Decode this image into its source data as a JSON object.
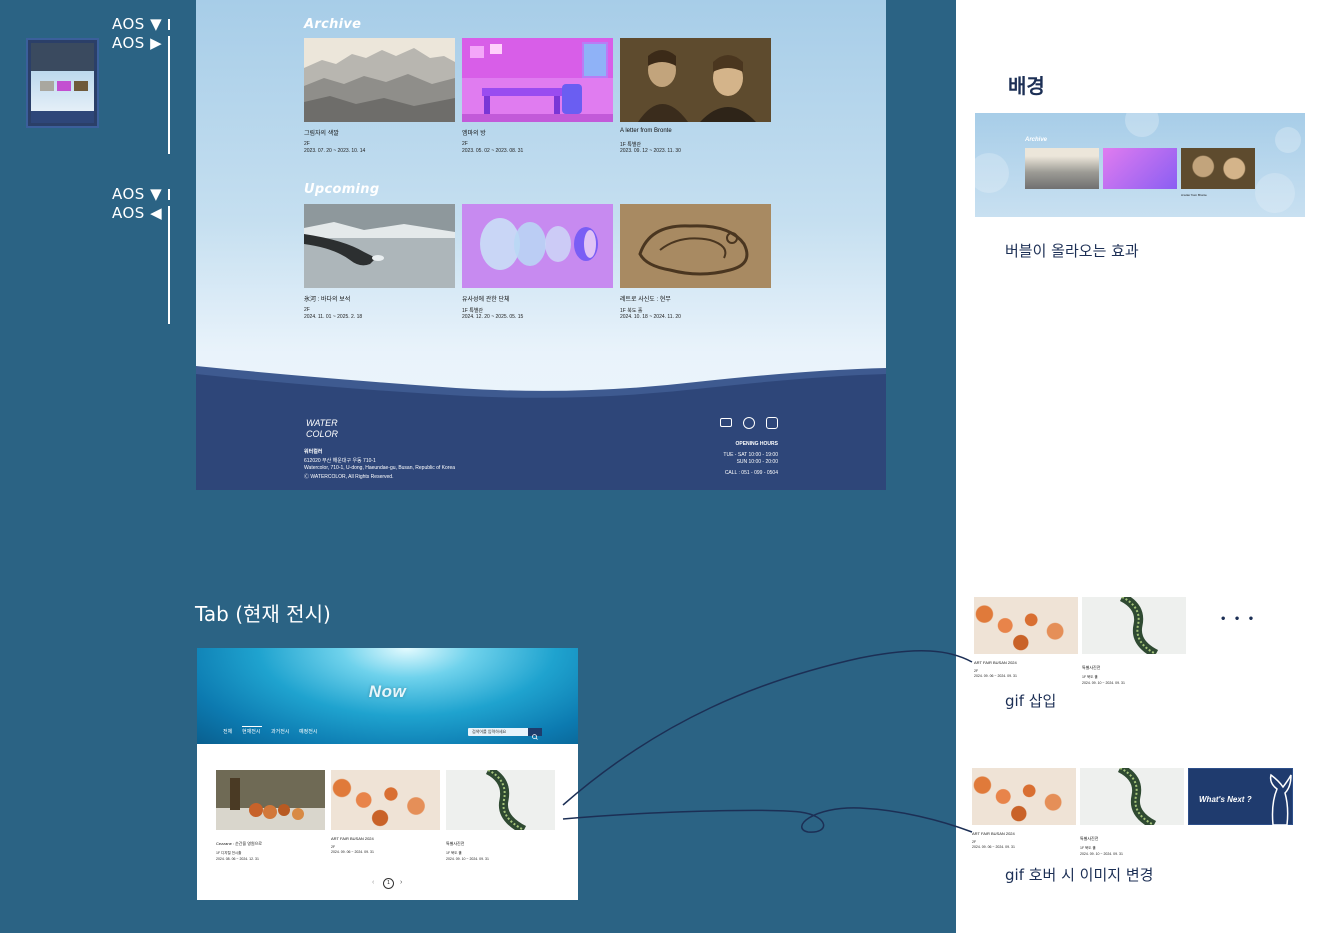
{
  "aos": {
    "group1": [
      "AOS ▼",
      "AOS ▶"
    ],
    "group2": [
      "AOS ▼",
      "AOS ◀"
    ]
  },
  "archive": {
    "title": "Archive",
    "items": [
      {
        "title": "그림자의 색깔",
        "floor": "2F",
        "date": "2023. 07. 20 ~ 2023. 10. 14"
      },
      {
        "title": "엠마의 방",
        "floor": "2F",
        "date": "2023. 05. 02 ~ 2023. 08. 31"
      },
      {
        "title": "A letter from Bronte",
        "floor": "1F 특별관",
        "date": "2023. 09. 12 ~ 2023. 11. 30"
      }
    ]
  },
  "upcoming": {
    "title": "Upcoming",
    "items": [
      {
        "title": "氷河 : 바다의 보석",
        "floor": "2F",
        "date": "2024. 11. 01 ~ 2025. 2. 18"
      },
      {
        "title": "유사성에 관한 단체",
        "floor": "1F 특별관",
        "date": "2024. 12. 20 ~ 2025. 05. 15"
      },
      {
        "title": "레트로 사신도 : 현무",
        "floor": "1F 북도 홀",
        "date": "2024. 10. 18 ~ 2024. 11. 20"
      }
    ]
  },
  "footer": {
    "logo_line1": "WATER",
    "logo_line2": "COLOR",
    "name": "워터컬러",
    "postal": "612020 부산 해운대구 우동 710-1",
    "address_en": "Watercolor, 710-1, U-dong, Haeundae-gu, Busan, Republic of Korea",
    "copyright": "Ⓒ WATERCOLOR, All Rights Reserved.",
    "hours_title": "OPENING HOURS",
    "hours_weekday": "TUE - SAT 10:00 - 19:00",
    "hours_sunday": "SUN 10:00 - 20:00",
    "call": "CALL : 051 - 099 - 0504"
  },
  "right_panel": {
    "bg_heading": "배경",
    "bubble_caption": "버블이 올라오는 효과",
    "bg_preview_title": "Archive",
    "bg_preview_card": "A letter from Bronte",
    "gif_insert_caption": "gif 삽입",
    "gif_hover_caption": "gif 호버 시 이미지 변경",
    "ellipsis": "• • •",
    "whats_next": "What's Next ?",
    "gif_cards": [
      {
        "title": "ART FAIR BUSAN 2024",
        "floor": "2F",
        "date": "2024. 09. 06 ~ 2024. 09. 31"
      },
      {
        "title": "특별사진전",
        "floor": "1F 북도 홀",
        "date": "2024. 09. 10 ~ 2024. 09. 31"
      }
    ]
  },
  "tab_section": {
    "caption": "Tab (현재 전시)",
    "hero_title": "Now",
    "nav": [
      "전체",
      "현재전시",
      "과거전시",
      "예정전시"
    ],
    "search_placeholder": "검색어를 입력하세요",
    "cards": [
      {
        "title": "Cezzane : 순간을 영원으로",
        "floor": "1F 디지털 전시홀",
        "date": "2024. 08. 06 ~ 2024. 12. 31"
      },
      {
        "title": "ART FAIR BUSAN 2024",
        "floor": "2F",
        "date": "2024. 09. 06 ~ 2024. 09. 31"
      },
      {
        "title": "특별사진전",
        "floor": "1F 북도 홀",
        "date": "2024. 09. 10 ~ 2024. 09. 31"
      }
    ],
    "pagination": {
      "prev": "‹",
      "current": "1",
      "next": "›"
    }
  },
  "colors": {
    "background": "#2b6384",
    "footer_navy": "#2e4679",
    "heading_navy": "#1c2f55",
    "sky_top": "#a7cde8"
  }
}
